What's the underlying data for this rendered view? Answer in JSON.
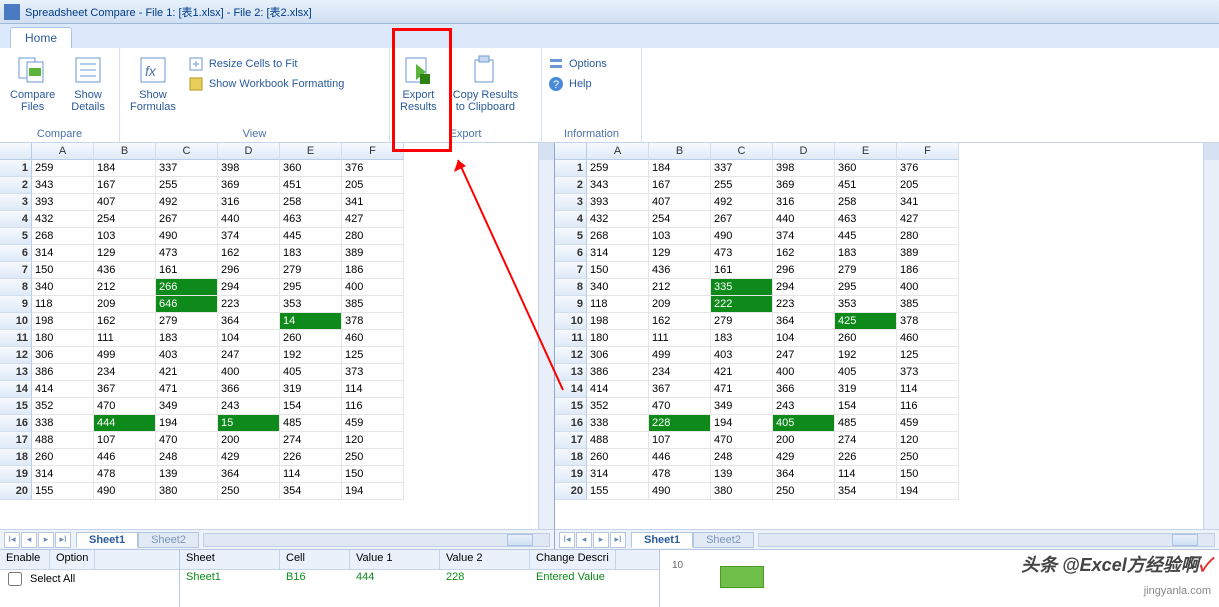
{
  "title": "Spreadsheet Compare - File 1: [表1.xlsx] - File 2: [表2.xlsx]",
  "tabs": {
    "home": "Home"
  },
  "ribbon": {
    "compare": {
      "compare_files": "Compare\nFiles",
      "show_details": "Show\nDetails",
      "label": "Compare"
    },
    "view": {
      "show_formulas": "Show\nFormulas",
      "resize": "Resize Cells to Fit",
      "formatting": "Show Workbook Formatting",
      "label": "View"
    },
    "export": {
      "export_results": "Export\nResults",
      "copy_clip": "Copy Results\nto Clipboard",
      "label": "Export"
    },
    "info": {
      "options": "Options",
      "help": "Help",
      "label": "Information"
    }
  },
  "columns": [
    "A",
    "B",
    "C",
    "D",
    "E",
    "F"
  ],
  "left_hl": {
    "8": [
      2
    ],
    "9": [
      2
    ],
    "10": [
      4
    ],
    "16": [
      1,
      3
    ]
  },
  "right_hl": {
    "8": [
      2
    ],
    "9": [
      2
    ],
    "10": [
      4
    ],
    "16": [
      1,
      3
    ]
  },
  "left_data": [
    [
      "259",
      "184",
      "337",
      "398",
      "360",
      "376"
    ],
    [
      "343",
      "167",
      "255",
      "369",
      "451",
      "205"
    ],
    [
      "393",
      "407",
      "492",
      "316",
      "258",
      "341"
    ],
    [
      "432",
      "254",
      "267",
      "440",
      "463",
      "427"
    ],
    [
      "268",
      "103",
      "490",
      "374",
      "445",
      "280"
    ],
    [
      "314",
      "129",
      "473",
      "162",
      "183",
      "389"
    ],
    [
      "150",
      "436",
      "161",
      "296",
      "279",
      "186"
    ],
    [
      "340",
      "212",
      "266",
      "294",
      "295",
      "400"
    ],
    [
      "118",
      "209",
      "646",
      "223",
      "353",
      "385"
    ],
    [
      "198",
      "162",
      "279",
      "364",
      "14",
      "378"
    ],
    [
      "180",
      "111",
      "183",
      "104",
      "260",
      "460"
    ],
    [
      "306",
      "499",
      "403",
      "247",
      "192",
      "125"
    ],
    [
      "386",
      "234",
      "421",
      "400",
      "405",
      "373"
    ],
    [
      "414",
      "367",
      "471",
      "366",
      "319",
      "114"
    ],
    [
      "352",
      "470",
      "349",
      "243",
      "154",
      "116"
    ],
    [
      "338",
      "444",
      "194",
      "15",
      "485",
      "459"
    ],
    [
      "488",
      "107",
      "470",
      "200",
      "274",
      "120"
    ],
    [
      "260",
      "446",
      "248",
      "429",
      "226",
      "250"
    ],
    [
      "314",
      "478",
      "139",
      "364",
      "114",
      "150"
    ],
    [
      "155",
      "490",
      "380",
      "250",
      "354",
      "194"
    ]
  ],
  "right_data": [
    [
      "259",
      "184",
      "337",
      "398",
      "360",
      "376"
    ],
    [
      "343",
      "167",
      "255",
      "369",
      "451",
      "205"
    ],
    [
      "393",
      "407",
      "492",
      "316",
      "258",
      "341"
    ],
    [
      "432",
      "254",
      "267",
      "440",
      "463",
      "427"
    ],
    [
      "268",
      "103",
      "490",
      "374",
      "445",
      "280"
    ],
    [
      "314",
      "129",
      "473",
      "162",
      "183",
      "389"
    ],
    [
      "150",
      "436",
      "161",
      "296",
      "279",
      "186"
    ],
    [
      "340",
      "212",
      "335",
      "294",
      "295",
      "400"
    ],
    [
      "118",
      "209",
      "222",
      "223",
      "353",
      "385"
    ],
    [
      "198",
      "162",
      "279",
      "364",
      "425",
      "378"
    ],
    [
      "180",
      "111",
      "183",
      "104",
      "260",
      "460"
    ],
    [
      "306",
      "499",
      "403",
      "247",
      "192",
      "125"
    ],
    [
      "386",
      "234",
      "421",
      "400",
      "405",
      "373"
    ],
    [
      "414",
      "367",
      "471",
      "366",
      "319",
      "114"
    ],
    [
      "352",
      "470",
      "349",
      "243",
      "154",
      "116"
    ],
    [
      "338",
      "228",
      "194",
      "405",
      "485",
      "459"
    ],
    [
      "488",
      "107",
      "470",
      "200",
      "274",
      "120"
    ],
    [
      "260",
      "446",
      "248",
      "429",
      "226",
      "250"
    ],
    [
      "314",
      "478",
      "139",
      "364",
      "114",
      "150"
    ],
    [
      "155",
      "490",
      "380",
      "250",
      "354",
      "194"
    ]
  ],
  "sheets": {
    "s1": "Sheet1",
    "s2": "Sheet2"
  },
  "options": {
    "hdr_enable": "Enable",
    "hdr_option": "Option",
    "select_all": "Select All"
  },
  "results": {
    "hdr_sheet": "Sheet",
    "hdr_cell": "Cell",
    "hdr_v1": "Value 1",
    "hdr_v2": "Value 2",
    "hdr_desc": "Change Descri",
    "row_sheet": "Sheet1",
    "row_cell": "B16",
    "row_v1": "444",
    "row_v2": "228",
    "row_desc": "Entered Value"
  },
  "chart_tick": "10",
  "watermark": "头条 @Excel方经验啊",
  "wm2": "jingyanla.com"
}
